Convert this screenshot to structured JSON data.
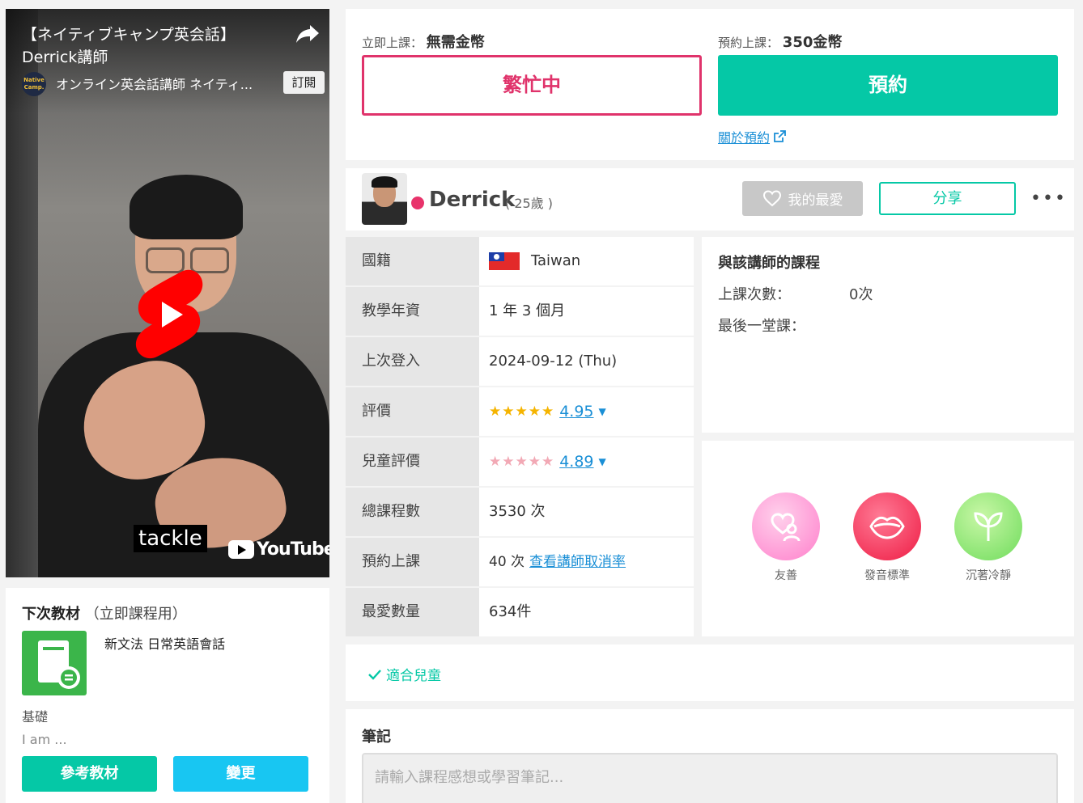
{
  "video": {
    "title": "【ネイティブキャンプ英会話】Derrick講師",
    "channel_logo_text": "Native Camp.",
    "channel_name": "オンライン英会話講師 ネイティ...",
    "subscribe_label": "訂閱",
    "caption": "tackle",
    "brand": "YouTube"
  },
  "material": {
    "heading_bold": "下次教材",
    "heading_note": "（立即課程用）",
    "book_name": "新文法 日常英語會話",
    "level": "基礎",
    "desc": "I am ...",
    "ref_button": "參考教材",
    "change_button": "變更"
  },
  "booking": {
    "now_label": "立即上課：",
    "now_price": "無需金幣",
    "reserve_label": "預約上課：",
    "reserve_price": "350金幣",
    "busy_button": "繁忙中",
    "reserve_button": "預約",
    "about_link": "關於預約"
  },
  "profile": {
    "name": "Derrick",
    "age": "( 25歲 )",
    "favorite_button": "我的最愛",
    "share_button": "分享",
    "more": "•••"
  },
  "info": {
    "nationality_label": "國籍",
    "nationality_value": "Taiwan",
    "years_label": "教學年資",
    "years_value": "1 年 3 個月",
    "last_login_label": "上次登入",
    "last_login_value": "2024-09-12 (Thu)",
    "rating_label": "評價",
    "rating_stars": "★★★★★",
    "rating_value": "4.95",
    "kids_rating_label": "兒童評價",
    "kids_rating_stars": "★★★★★",
    "kids_rating_value": "4.89",
    "total_label": "總課程數",
    "total_value": "3530 次",
    "reserved_label": "預約上課",
    "reserved_value": "40 次",
    "cancel_rate_link": "查看講師取消率",
    "favorites_label": "最愛數量",
    "favorites_value": "634件"
  },
  "course": {
    "title": "與該講師的課程",
    "count_label": "上課次數：",
    "count_value": "0次",
    "last_label": "最後一堂課："
  },
  "traits": [
    {
      "label": "友善",
      "icon": "heart-person-icon"
    },
    {
      "label": "發音標準",
      "icon": "lips-icon"
    },
    {
      "label": "沉著冷靜",
      "icon": "sprout-icon"
    }
  ],
  "kids": {
    "tag": "適合兒童"
  },
  "notes": {
    "title": "筆記",
    "placeholder": "請輸入課程感想或學習筆記..."
  },
  "colors": {
    "accent": "#05c8a6",
    "busy": "#e0336b",
    "link": "#1a8fd6",
    "change_button": "#18c6f2"
  }
}
